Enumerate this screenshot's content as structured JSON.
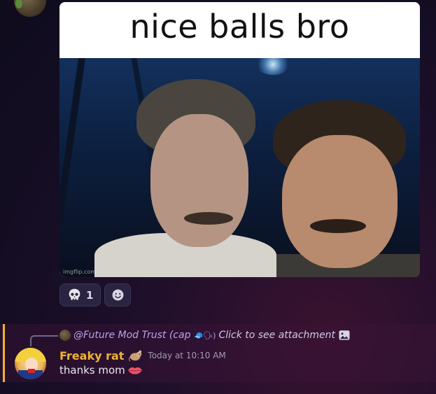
{
  "meme": {
    "caption": "nice balls bro",
    "watermark": "imgflip.com"
  },
  "reactions": [
    {
      "icon": "skull-icon",
      "count": "1"
    },
    {
      "icon": "add-reaction-icon"
    }
  ],
  "reply": {
    "username": "@Future Mod Trust (cap",
    "emoji": "🧢🗣)",
    "text": "Click to see attachment",
    "icon": "image-icon"
  },
  "message": {
    "username": "Freaky rat",
    "badge_icon": "rat-badge-icon",
    "timestamp": "Today at 10:10 AM",
    "text": "thanks mom",
    "trailing_emoji": "lips-icon",
    "username_color": "#f0b232"
  },
  "colors": {
    "accent_bar": "#f0b232",
    "reply_user": "#b9a5ea"
  }
}
